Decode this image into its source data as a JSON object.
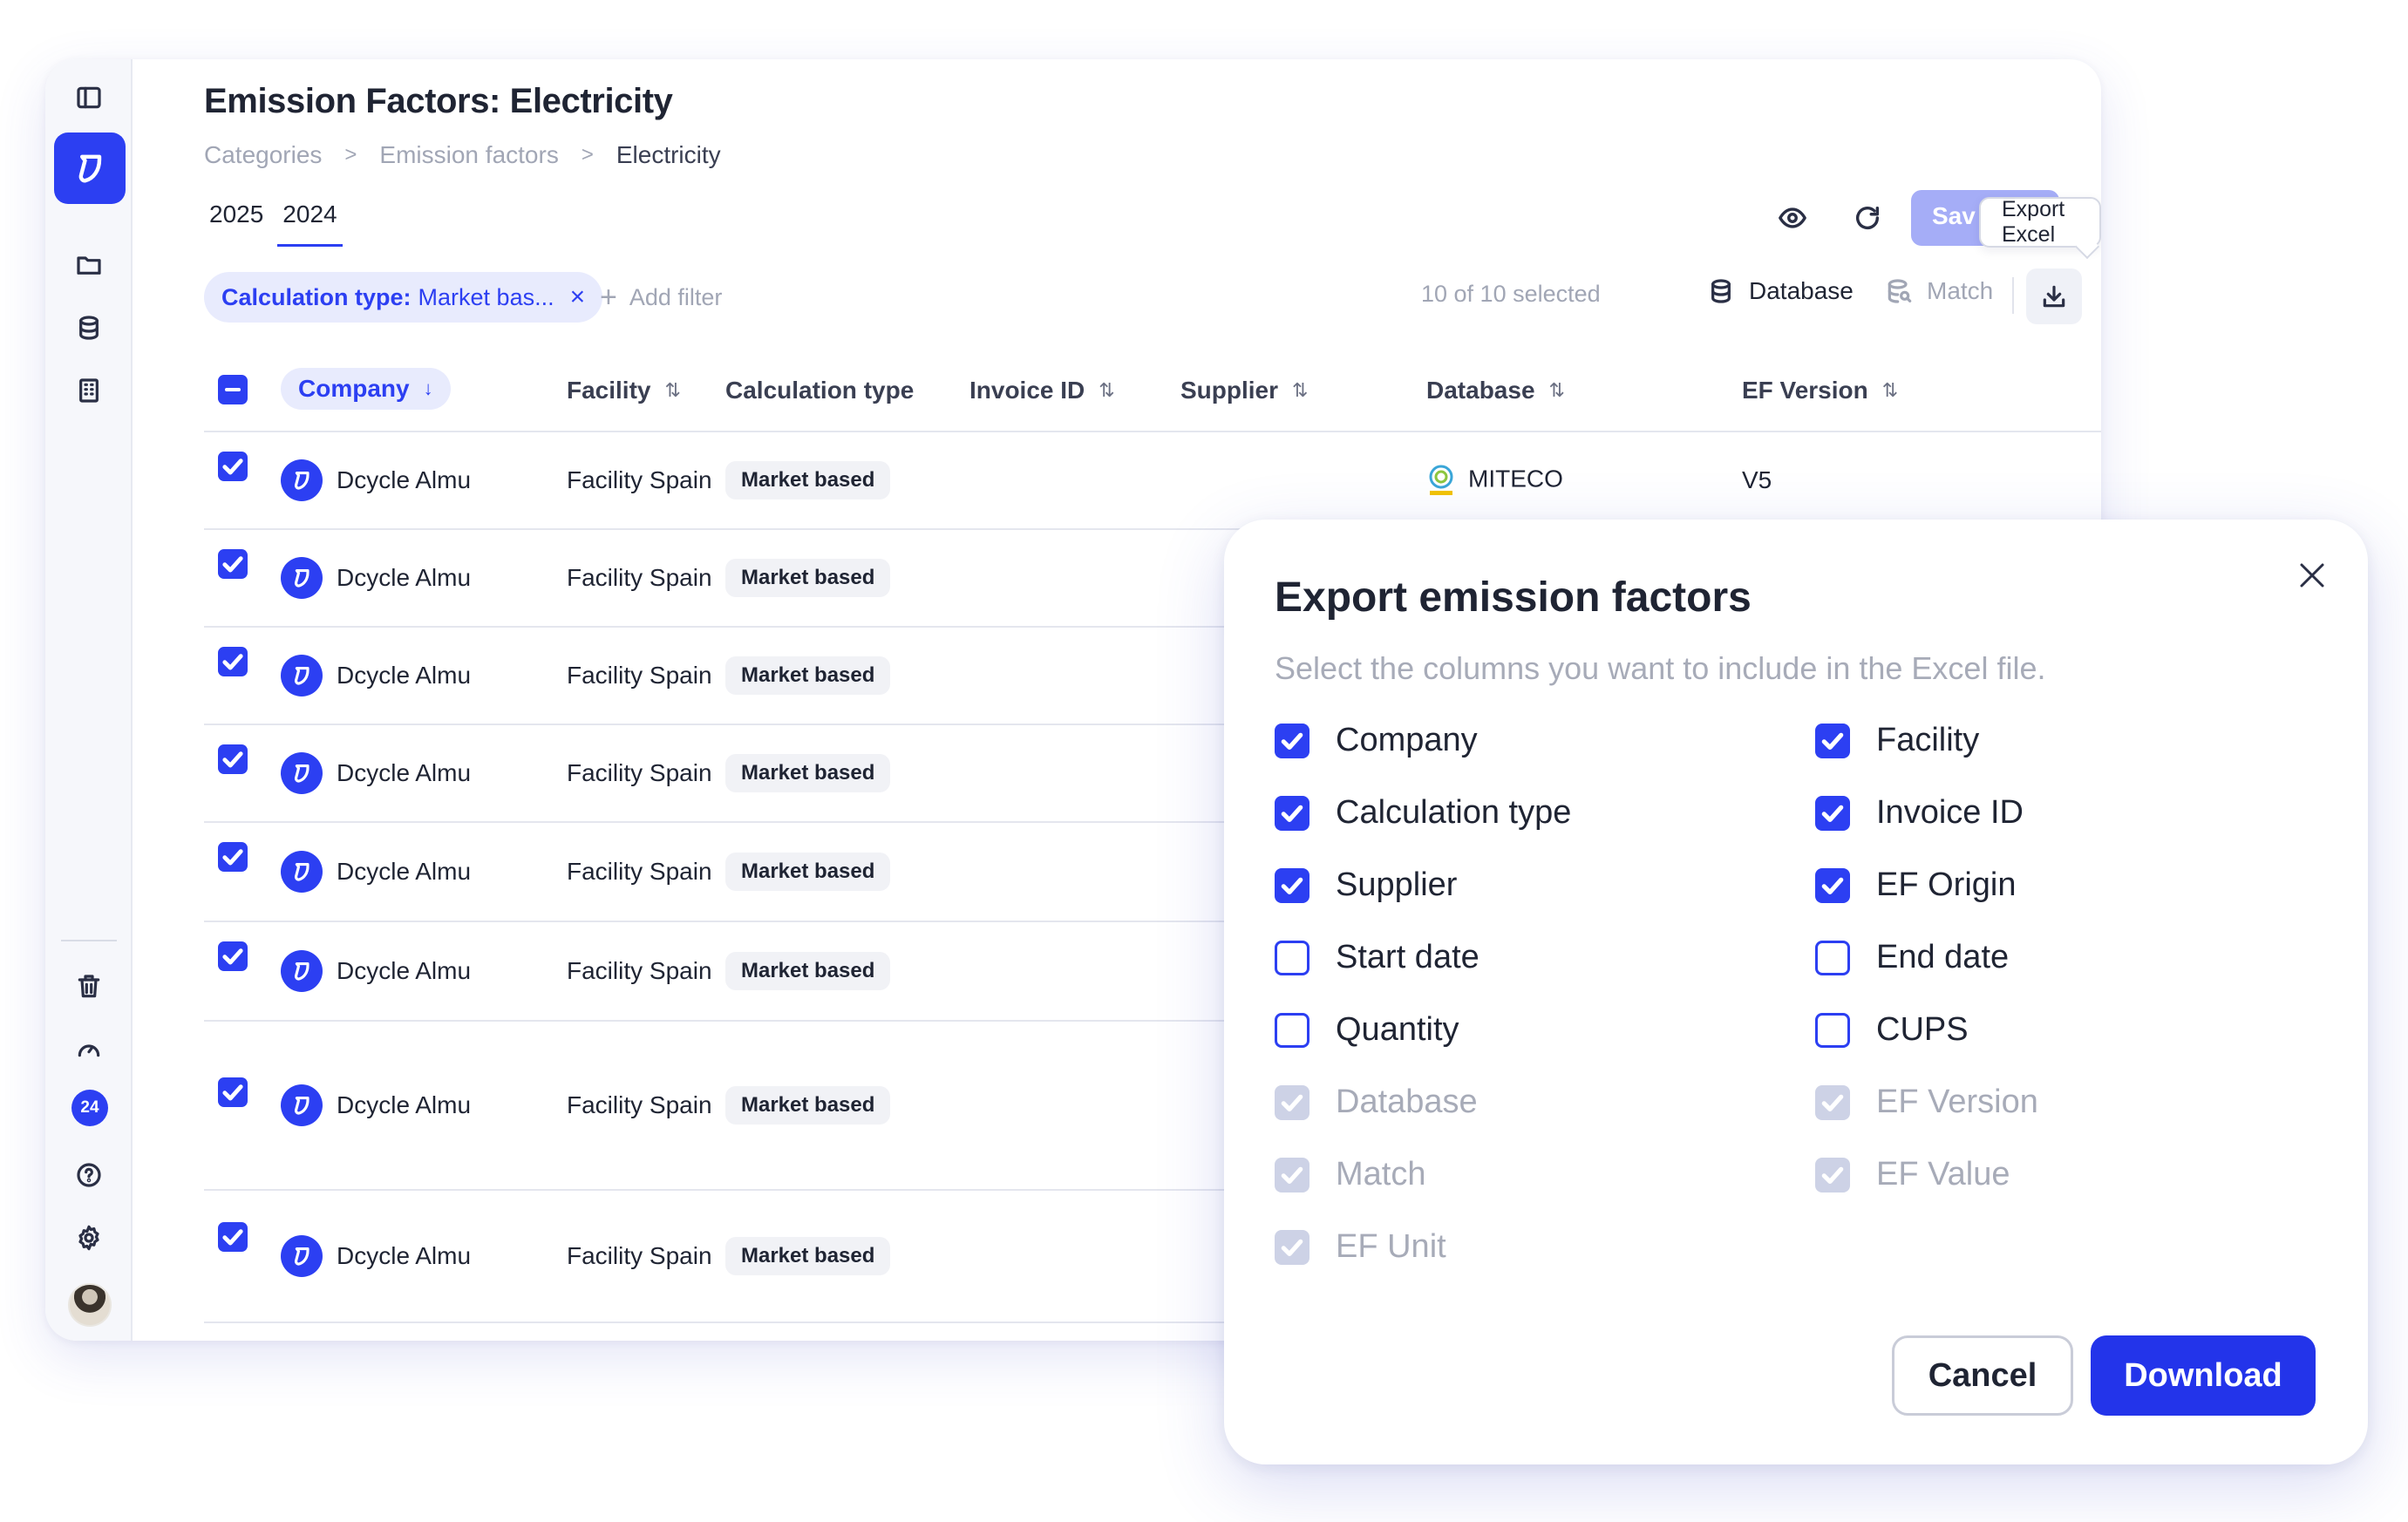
{
  "page": {
    "title": "Emission Factors: Electricity",
    "breadcrumb": [
      "Categories",
      "Emission factors",
      "Electricity"
    ],
    "years": [
      "2025",
      "2024"
    ],
    "active_year": "2024",
    "save_label": "Sav",
    "tooltip": "Export Excel"
  },
  "sidebar": {
    "badge": "24",
    "icons": [
      "panel-toggle-icon",
      "logo-icon",
      "folder-icon",
      "database-icon",
      "building-icon",
      "trash-icon",
      "gauge-icon",
      "help-icon",
      "gear-icon"
    ]
  },
  "toolbar": {
    "filter_key": "Calculation type:",
    "filter_value": "Market bas...",
    "filter_remove": "×",
    "add_filter": "Add filter",
    "selected_count": "10 of 10 selected",
    "database_label": "Database",
    "match_label": "Match"
  },
  "table": {
    "columns": [
      "Company",
      "Facility",
      "Calculation type",
      "Invoice ID",
      "Supplier",
      "Database",
      "EF Version"
    ],
    "sort_company": "↓",
    "sort_other": "⇅",
    "rows": [
      {
        "company": "Dcycle Almu",
        "facility": "Facility Spain",
        "calc": "Market based",
        "database": "MITECO",
        "version": "V5"
      },
      {
        "company": "Dcycle Almu",
        "facility": "Facility Spain",
        "calc": "Market based"
      },
      {
        "company": "Dcycle Almu",
        "facility": "Facility Spain",
        "calc": "Market based"
      },
      {
        "company": "Dcycle Almu",
        "facility": "Facility Spain",
        "calc": "Market based"
      },
      {
        "company": "Dcycle Almu",
        "facility": "Facility Spain",
        "calc": "Market based"
      },
      {
        "company": "Dcycle Almu",
        "facility": "Facility Spain",
        "calc": "Market based"
      },
      {
        "company": "Dcycle Almu",
        "facility": "Facility Spain",
        "calc": "Market based"
      },
      {
        "company": "Dcycle Almu",
        "facility": "Facility Spain",
        "calc": "Market based"
      }
    ]
  },
  "modal": {
    "title": "Export emission factors",
    "subtitle": "Select the columns you want to include in the Excel file.",
    "options": [
      {
        "label": "Company",
        "checked": true,
        "disabled": false
      },
      {
        "label": "Facility",
        "checked": true,
        "disabled": false
      },
      {
        "label": "Calculation type",
        "checked": true,
        "disabled": false
      },
      {
        "label": "Invoice ID",
        "checked": true,
        "disabled": false
      },
      {
        "label": "Supplier",
        "checked": true,
        "disabled": false
      },
      {
        "label": "EF Origin",
        "checked": true,
        "disabled": false
      },
      {
        "label": "Start date",
        "checked": false,
        "disabled": false
      },
      {
        "label": "End date",
        "checked": false,
        "disabled": false
      },
      {
        "label": "Quantity",
        "checked": false,
        "disabled": false
      },
      {
        "label": "CUPS",
        "checked": false,
        "disabled": false
      },
      {
        "label": "Database",
        "checked": true,
        "disabled": true
      },
      {
        "label": "EF Version",
        "checked": true,
        "disabled": true
      },
      {
        "label": "Match",
        "checked": true,
        "disabled": true
      },
      {
        "label": "EF Value",
        "checked": true,
        "disabled": true
      },
      {
        "label": "EF Unit",
        "checked": true,
        "disabled": true
      }
    ],
    "cancel_label": "Cancel",
    "download_label": "Download"
  },
  "colors": {
    "accent": "#2c3ff2",
    "accent_light": "#e8ebfd",
    "disabled_check": "#cdd2e6",
    "muted_text": "#a1a6b5"
  }
}
